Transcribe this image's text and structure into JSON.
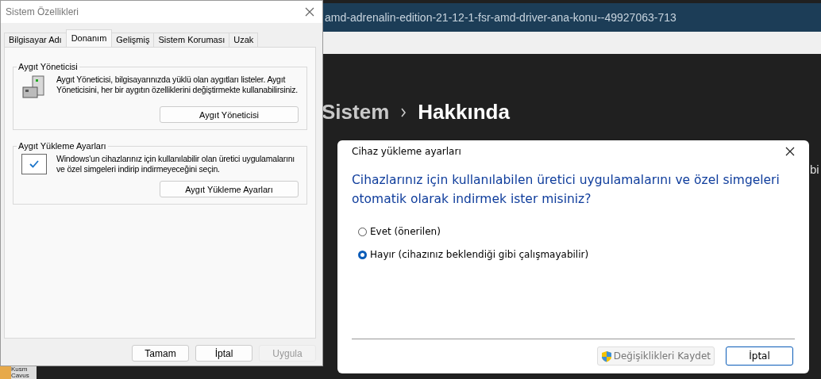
{
  "browser": {
    "address": "amd-adrenalin-edition-21-12-1-fsr-amd-driver-ana-konu--49927063-713"
  },
  "settings": {
    "breadcrumb": [
      {
        "label": "Sistem",
        "selected": false
      },
      {
        "label": "Hakkında",
        "selected": true
      }
    ],
    "side_text": "bi",
    "corner_texts": [
      "Kusm",
      "Cavus"
    ]
  },
  "system_properties": {
    "title": "Sistem Özellikleri",
    "tabs": [
      {
        "label": "Bilgisayar Adı",
        "selected": false
      },
      {
        "label": "Donanım",
        "selected": true
      },
      {
        "label": "Gelişmiş",
        "selected": false
      },
      {
        "label": "Sistem Koruması",
        "selected": false
      },
      {
        "label": "Uzak",
        "selected": false
      }
    ],
    "groups": [
      {
        "title": "Aygıt Yöneticisi",
        "kind": "device",
        "text": "Aygıt Yöneticisi, bilgisayarınızda yüklü olan aygıtları listeler. Aygıt Yöneticisini, her bir aygıtın özelliklerini değiştirmekte kullanabilirsiniz.",
        "button": "Aygıt Yöneticisi"
      },
      {
        "title": "Aygıt Yükleme Ayarları",
        "kind": "install",
        "text": "Windows'un cihazlarınız için kullanılabilir olan üretici uygulamalarını ve özel simgeleri indirip indirmeyeceğini seçin.",
        "button": "Aygıt Yükleme Ayarları"
      }
    ],
    "buttons": [
      {
        "label": "Tamam",
        "disabled": false
      },
      {
        "label": "İptal",
        "disabled": false
      },
      {
        "label": "Uygula",
        "disabled": true
      }
    ]
  },
  "install_dialog": {
    "title": "Cihaz yükleme ayarları",
    "question": "Cihazlarınız için kullanılabilen üretici uygulamalarını ve özel simgeleri otomatik olarak indirmek ister misiniz?",
    "options": [
      {
        "label": "Evet (önerilen)",
        "selected": false
      },
      {
        "label": "Hayır (cihazınız beklendiği gibi çalışmayabilir)",
        "selected": true
      }
    ],
    "buttons": [
      {
        "label": "Değişiklikleri Kaydet",
        "kind": "shield",
        "disabled": true
      },
      {
        "label": "İptal",
        "kind": "plain",
        "disabled": false
      }
    ]
  }
}
